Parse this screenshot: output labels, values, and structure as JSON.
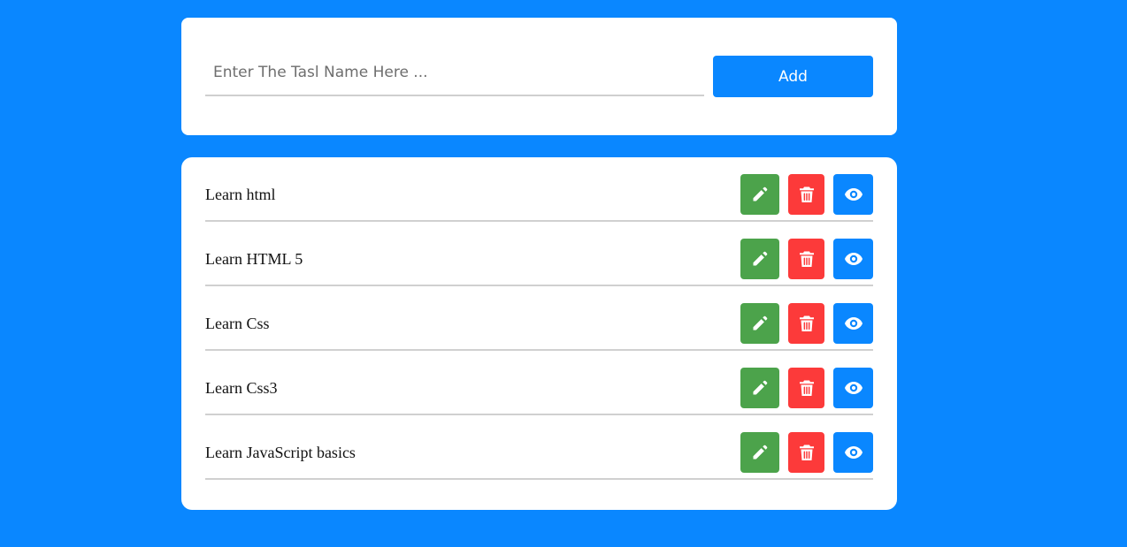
{
  "add_form": {
    "placeholder": "Enter The Tasl Name Here ...",
    "value": "",
    "add_label": "Add"
  },
  "tasks": [
    {
      "label": "Learn html"
    },
    {
      "label": "Learn HTML 5"
    },
    {
      "label": "Learn Css"
    },
    {
      "label": "Learn Css3"
    },
    {
      "label": "Learn JavaScript basics"
    }
  ],
  "icons": {
    "edit": "pencil-icon",
    "delete": "trash-icon",
    "view": "eye-icon"
  },
  "colors": {
    "background": "#0a87ff",
    "primary": "#0a87ff",
    "edit": "#4ca34b",
    "delete": "#fc3a3a",
    "card": "#ffffff"
  }
}
